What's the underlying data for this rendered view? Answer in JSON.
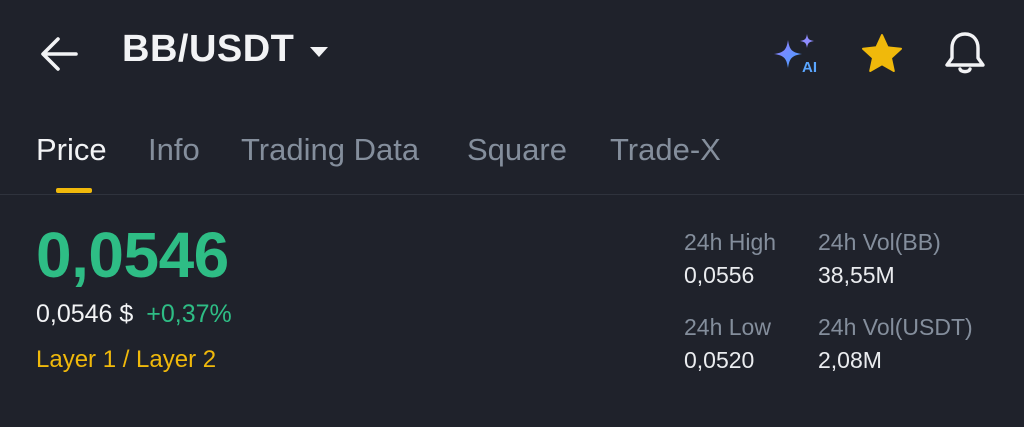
{
  "header": {
    "pair": "BB/USDT",
    "icons": {
      "back": "arrow-left-icon",
      "dropdown": "caret-down-icon",
      "ai": "ai-sparkle-icon",
      "favorite": "star-icon",
      "alert": "bell-icon"
    },
    "colors": {
      "favorite": "#f0b90b",
      "ai_gradient_start": "#7b6cff",
      "ai_gradient_end": "#3fa3ff"
    }
  },
  "tabs": [
    {
      "label": "Price",
      "active": true
    },
    {
      "label": "Info",
      "active": false
    },
    {
      "label": "Trading Data",
      "active": false
    },
    {
      "label": "Square",
      "active": false
    },
    {
      "label": "Trade-X",
      "active": false
    }
  ],
  "price": {
    "last": "0,0546",
    "usd": "0,0546 $",
    "change": "+0,37%",
    "sector": "Layer 1 / Layer 2"
  },
  "stats": {
    "high_label": "24h High",
    "high_value": "0,0556",
    "low_label": "24h Low",
    "low_value": "0,0520",
    "vol_base_label": "24h Vol(BB)",
    "vol_base_value": "38,55M",
    "vol_quote_label": "24h Vol(USDT)",
    "vol_quote_value": "2,08M"
  },
  "colors": {
    "background": "#1f222b",
    "up": "#2ebd85",
    "accent": "#f0b90b",
    "muted": "#848e9c",
    "text": "#eaecef"
  }
}
